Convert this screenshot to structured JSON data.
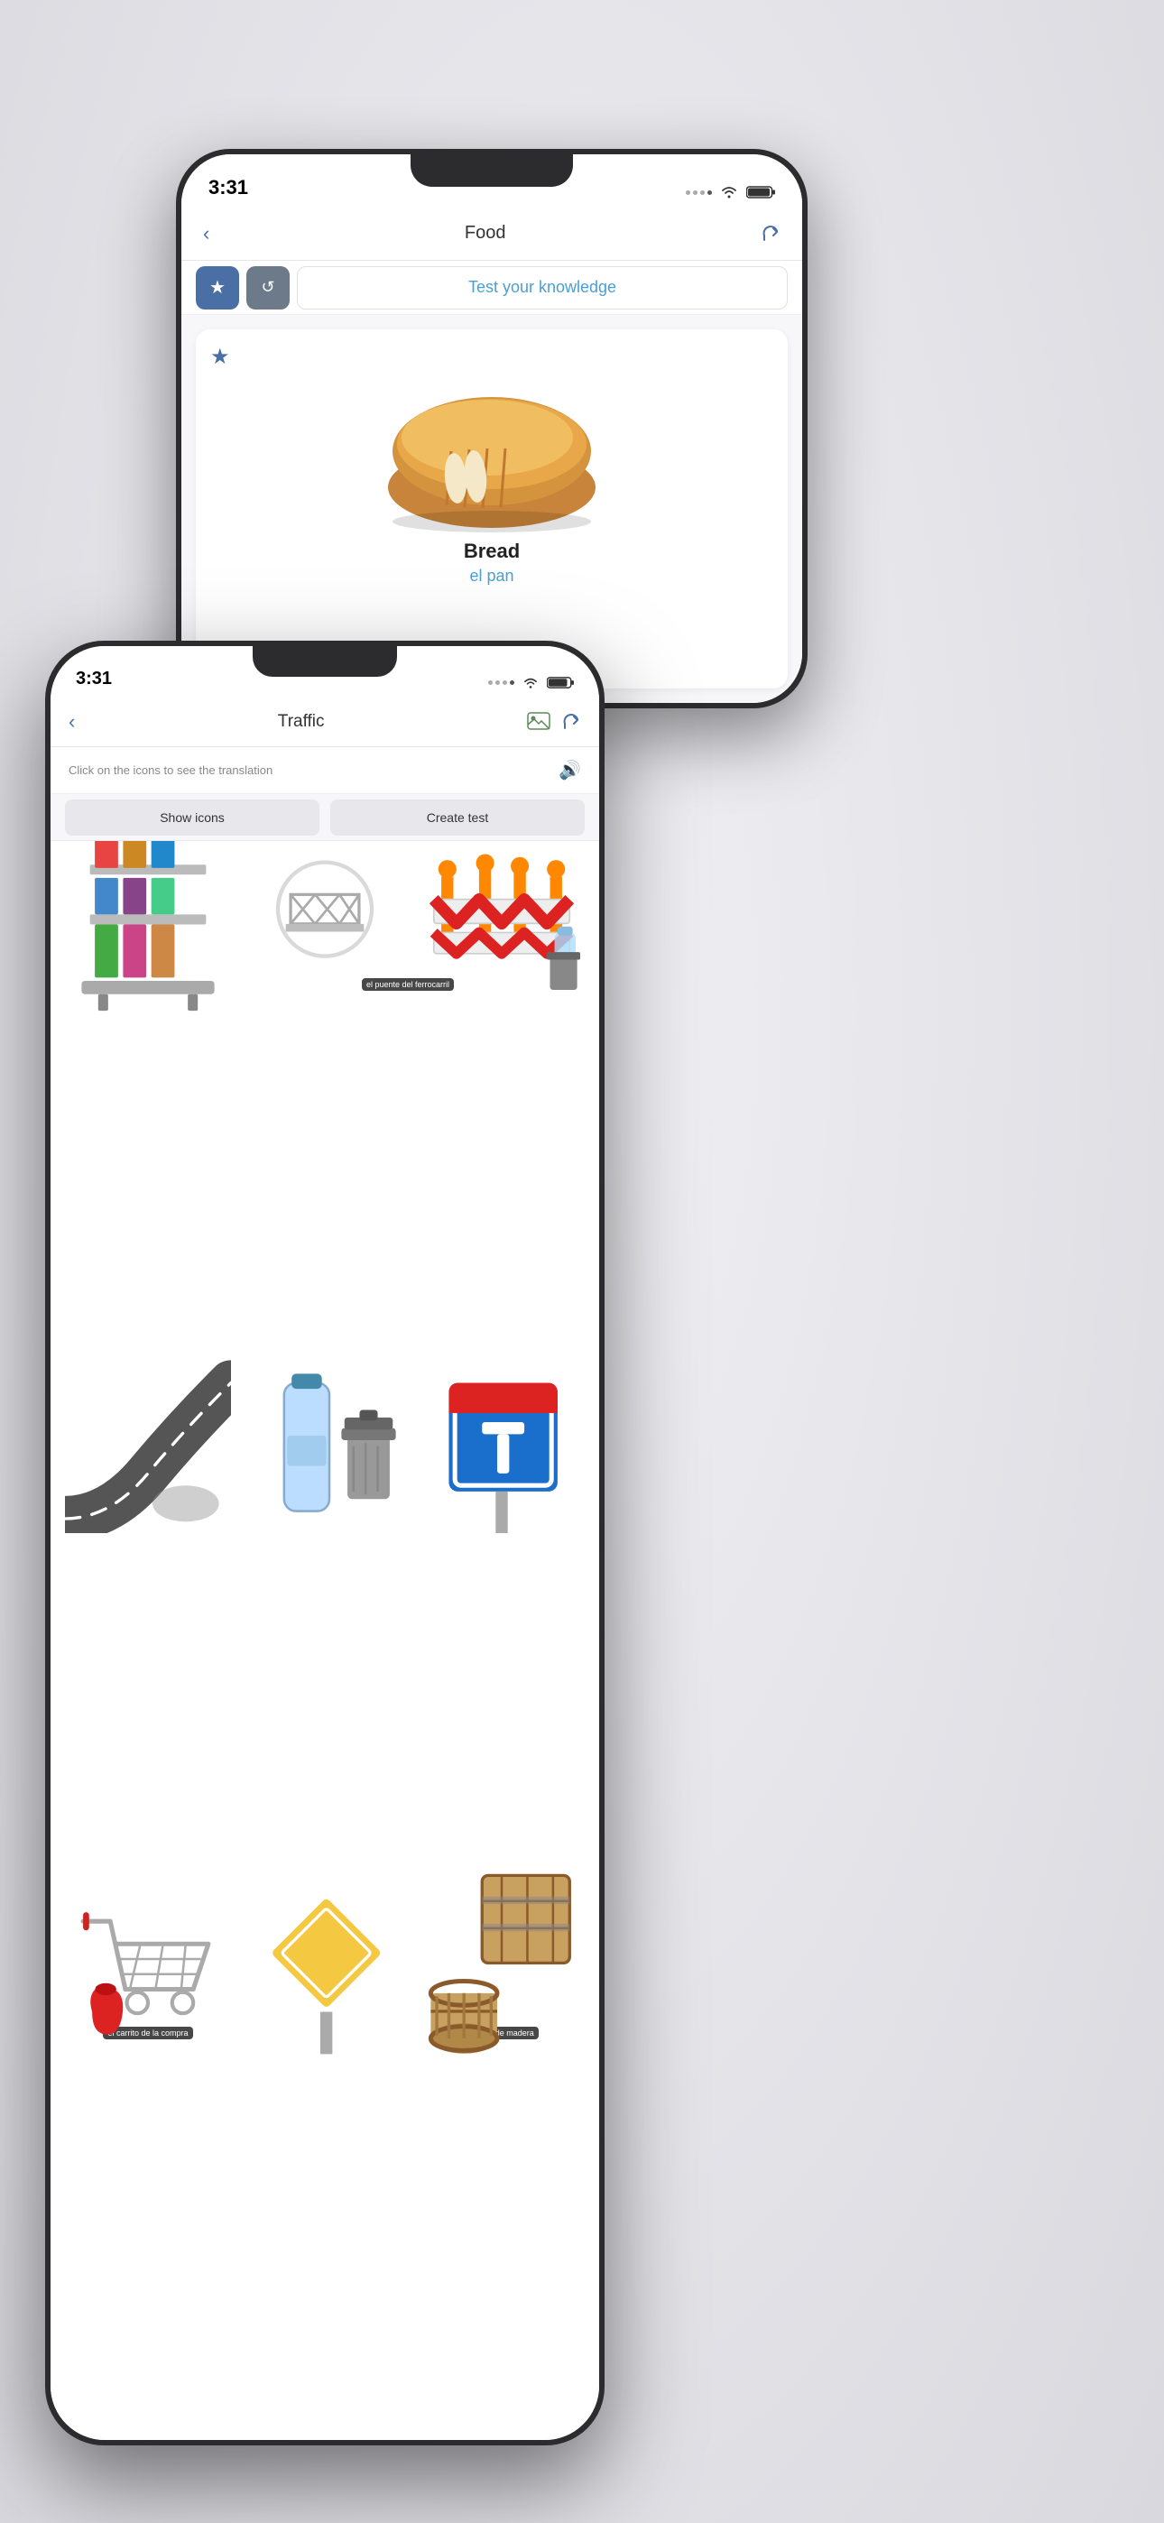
{
  "phone_back": {
    "status_bar": {
      "time": "3:31"
    },
    "nav": {
      "title": "Food",
      "back_label": "‹",
      "share_label": "⬆"
    },
    "actions": {
      "test_knowledge_label": "Test your knowledge",
      "star_icon": "★",
      "refresh_icon": "↺"
    },
    "card": {
      "star_icon": "★",
      "word_english": "Bread",
      "word_spanish": "el pan"
    }
  },
  "phone_front": {
    "status_bar": {
      "time": "3:31"
    },
    "nav": {
      "title": "Traffic",
      "back_label": "‹"
    },
    "instruction": {
      "text": "Click on the icons to see the translation"
    },
    "buttons": {
      "show_icons": "Show icons",
      "create_test": "Create test"
    },
    "grid": {
      "items": [
        {
          "label": "",
          "tooltip": ""
        },
        {
          "label": "",
          "tooltip": "el puente del ferrocarril"
        },
        {
          "label": "",
          "tooltip": ""
        },
        {
          "label": "",
          "tooltip": ""
        },
        {
          "label": "",
          "tooltip": ""
        },
        {
          "label": "",
          "tooltip": ""
        },
        {
          "label": "",
          "tooltip": "el carrito de la compra"
        },
        {
          "label": "",
          "tooltip": ""
        },
        {
          "label": "",
          "tooltip": "la caja de madera"
        }
      ]
    }
  }
}
